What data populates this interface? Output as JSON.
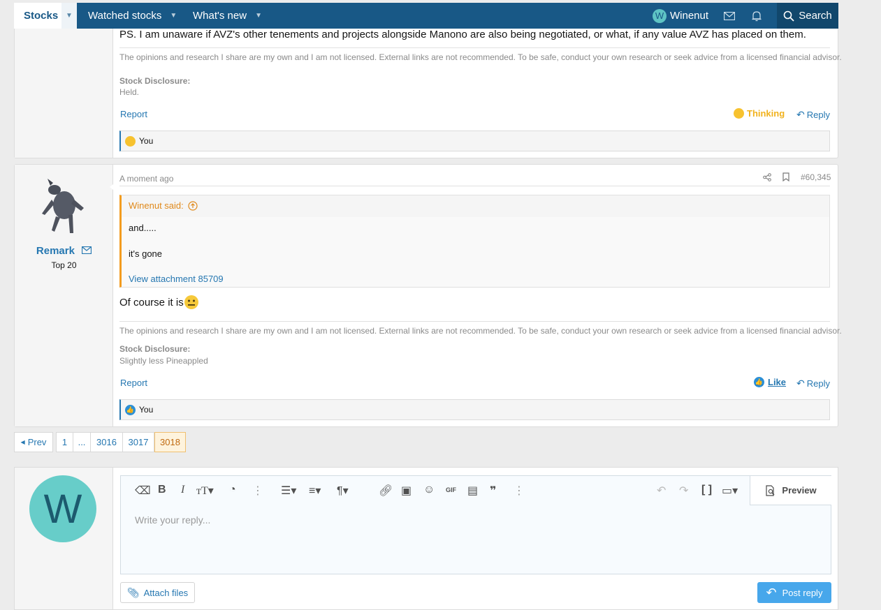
{
  "nav": {
    "tabs": [
      {
        "label": "Stocks"
      },
      {
        "label": "Watched stocks"
      },
      {
        "label": "What's new"
      }
    ],
    "user": {
      "initial": "W",
      "name": "Winenut"
    },
    "search_label": "Search"
  },
  "post1": {
    "body_tail": "PS. I am unaware if AVZ's other tenements and projects alongside Manono are also being negotiated, or what, if any value AVZ has placed on them.",
    "signature": "The opinions and research I share are my own and I am not licensed. External links are not recommended. To be safe, conduct your own research or seek advice from a licensed financial advisor.",
    "disclosure_label": "Stock Disclosure:",
    "disclosure_value": "Held.",
    "report_label": "Report",
    "reaction_label": "Thinking",
    "reply_label": "Reply",
    "reacted_by": "You"
  },
  "post2": {
    "author": "Remark",
    "rank": "Top 20",
    "time": "A moment ago",
    "post_number": "#60,345",
    "quote": {
      "author_said": "Winenut said:",
      "line1": "and.....",
      "line2": "it's gone",
      "attachment_link": "View attachment 85709"
    },
    "body": "Of course it is",
    "signature": "The opinions and research I share are my own and I am not licensed. External links are not recommended. To be safe, conduct your own research or seek advice from a licensed financial advisor.",
    "disclosure_label": "Stock Disclosure:",
    "disclosure_value": "Slightly less Pineappled",
    "report_label": "Report",
    "like_label": "Like",
    "reply_label": "Reply",
    "reacted_by": "You"
  },
  "pagination": {
    "prev_label": "Prev",
    "pages": [
      "1",
      "...",
      "3016",
      "3017",
      "3018"
    ],
    "current": "3018"
  },
  "reply_editor": {
    "avatar_initial": "W",
    "placeholder": "Write your reply...",
    "preview_label": "Preview",
    "attach_label": "Attach files",
    "post_label": "Post reply"
  },
  "colors": {
    "nav_bg": "#185886",
    "link": "#2577b1",
    "quote_accent": "#f39c1f",
    "thinking": "#f1b21c",
    "post_button": "#47a7eb",
    "avatar": "#67cdc9"
  }
}
